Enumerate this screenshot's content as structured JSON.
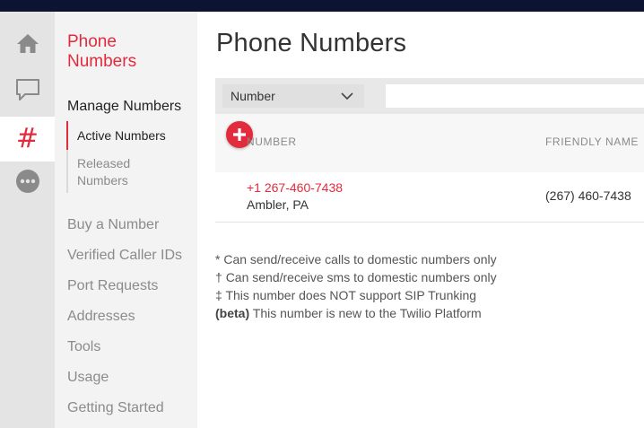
{
  "rail": {
    "items": [
      {
        "name": "home-icon"
      },
      {
        "name": "chat-icon"
      },
      {
        "name": "hash-icon",
        "glyph": "#"
      },
      {
        "name": "more-icon"
      }
    ],
    "accent_color": "#e22b3c"
  },
  "subnav": {
    "title": "Phone Numbers",
    "section": "Manage Numbers",
    "subitems": [
      "Active Numbers",
      "Released Numbers"
    ],
    "links": [
      "Buy a Number",
      "Verified Caller IDs",
      "Port Requests",
      "Addresses",
      "Tools",
      "Usage",
      "Getting Started"
    ]
  },
  "main": {
    "title": "Phone Numbers",
    "filter": {
      "selected": "Number",
      "search_value": ""
    },
    "columns": [
      "NUMBER",
      "FRIENDLY NAME"
    ],
    "rows": [
      {
        "number": "+1 267-460-7438",
        "location": "Ambler, PA",
        "friendly_name": "(267) 460-7438"
      }
    ],
    "notes": [
      {
        "symbol": "*",
        "text": "Can send/receive calls to domestic numbers only"
      },
      {
        "symbol": "†",
        "text": "Can send/receive sms to domestic numbers only"
      },
      {
        "symbol": "‡",
        "text": "This number does NOT support SIP Trunking"
      },
      {
        "symbol": "(beta)",
        "text": "This number is new to the Twilio Platform"
      }
    ]
  }
}
